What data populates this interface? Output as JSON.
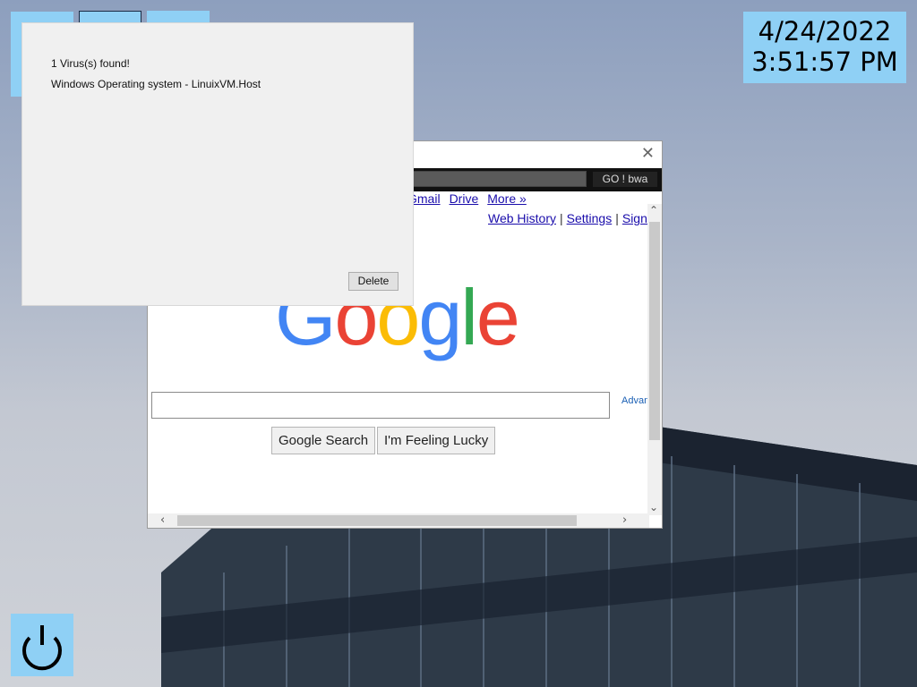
{
  "clock": {
    "date": "4/24/2022",
    "time": "3:51:57 PM"
  },
  "desktop": {
    "icons": [
      {
        "name": "app-icon-1"
      },
      {
        "name": "app-icon-2"
      },
      {
        "name": "app-icon-3"
      }
    ],
    "power_icon": "power-icon"
  },
  "browser": {
    "go_label": "GO ! bwa",
    "top_links": [
      "Gmail",
      "Drive",
      "More »"
    ],
    "account_links": [
      "Web History",
      "Settings",
      "Sign in"
    ],
    "logo_text": [
      "G",
      "o",
      "o",
      "g",
      "l",
      "e"
    ],
    "logo_colors": [
      "#4285F4",
      "#EA4335",
      "#FBBC05",
      "#4285F4",
      "#34A853",
      "#EA4335"
    ],
    "search_value": "",
    "advanced_link": "Advan",
    "search_button": "Google Search",
    "lucky_button": "I'm Feeling Lucky"
  },
  "dialog": {
    "message": "1 Virus(s) found!",
    "detail": "Windows Operating system - LinuixVM.Host",
    "delete_label": "Delete"
  }
}
